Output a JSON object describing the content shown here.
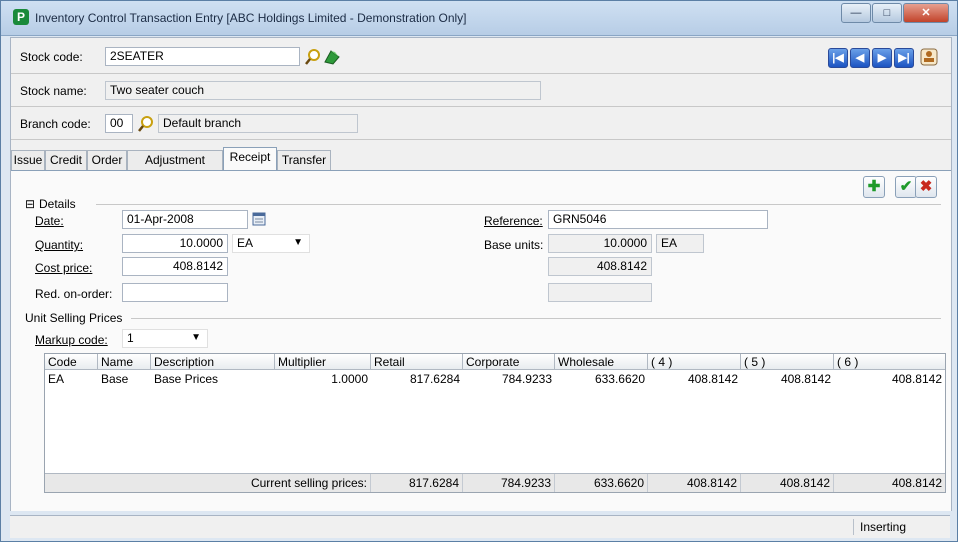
{
  "window": {
    "title": "Inventory Control Transaction Entry [ABC Holdings Limited - Demonstration Only]",
    "app_icon": "P"
  },
  "header": {
    "stock_code_label": "Stock code:",
    "stock_code_value": "2SEATER",
    "stock_name_label": "Stock name:",
    "stock_name_value": "Two seater couch",
    "branch_code_label": "Branch code:",
    "branch_code_value": "00",
    "branch_name_value": "Default branch"
  },
  "nav_buttons": [
    "first",
    "previous",
    "next",
    "last"
  ],
  "tabs": [
    {
      "label": "Issue",
      "active": false
    },
    {
      "label": "Credit",
      "active": false
    },
    {
      "label": "Order",
      "active": false
    },
    {
      "label": "Adjustment",
      "active": false
    },
    {
      "label": "Receipt",
      "active": true
    },
    {
      "label": "Transfer",
      "active": false
    }
  ],
  "details": {
    "group_label": "Details",
    "date_label": "Date:",
    "date_value": "01-Apr-2008",
    "quantity_label": "Quantity:",
    "quantity_value": "10.0000",
    "unit_value": "EA",
    "cost_price_label": "Cost price:",
    "cost_price_value": "408.8142",
    "red_on_order_label": "Red. on-order:",
    "red_on_order_value": "",
    "reference_label": "Reference:",
    "reference_value": "GRN5046",
    "base_units_label": "Base units:",
    "base_units_value": "10.0000",
    "base_unit_code": "EA",
    "base_cost_value": "408.8142",
    "base_extra_value": ""
  },
  "selling": {
    "group_label": "Unit Selling Prices",
    "markup_label": "Markup code:",
    "markup_value": "1"
  },
  "grid": {
    "columns": [
      "Code",
      "Name",
      "Description",
      "Multiplier",
      "Retail",
      "Corporate",
      "Wholesale",
      "( 4 )",
      "( 5 )",
      "( 6 )"
    ],
    "rows": [
      [
        "EA",
        "Base",
        "Base Prices",
        "1.0000",
        "817.6284",
        "784.9233",
        "633.6620",
        "408.8142",
        "408.8142",
        "408.8142"
      ]
    ],
    "footer_label": "Current selling prices:",
    "footer_values": [
      "817.6284",
      "784.9233",
      "633.6620",
      "408.8142",
      "408.8142",
      "408.8142"
    ]
  },
  "status": {
    "mode": "Inserting"
  },
  "icons": {
    "colors": {
      "add": "#1e9a2a",
      "ok": "#1e9a2a",
      "cancel": "#c8281e",
      "nav": "#1c54c2"
    }
  }
}
